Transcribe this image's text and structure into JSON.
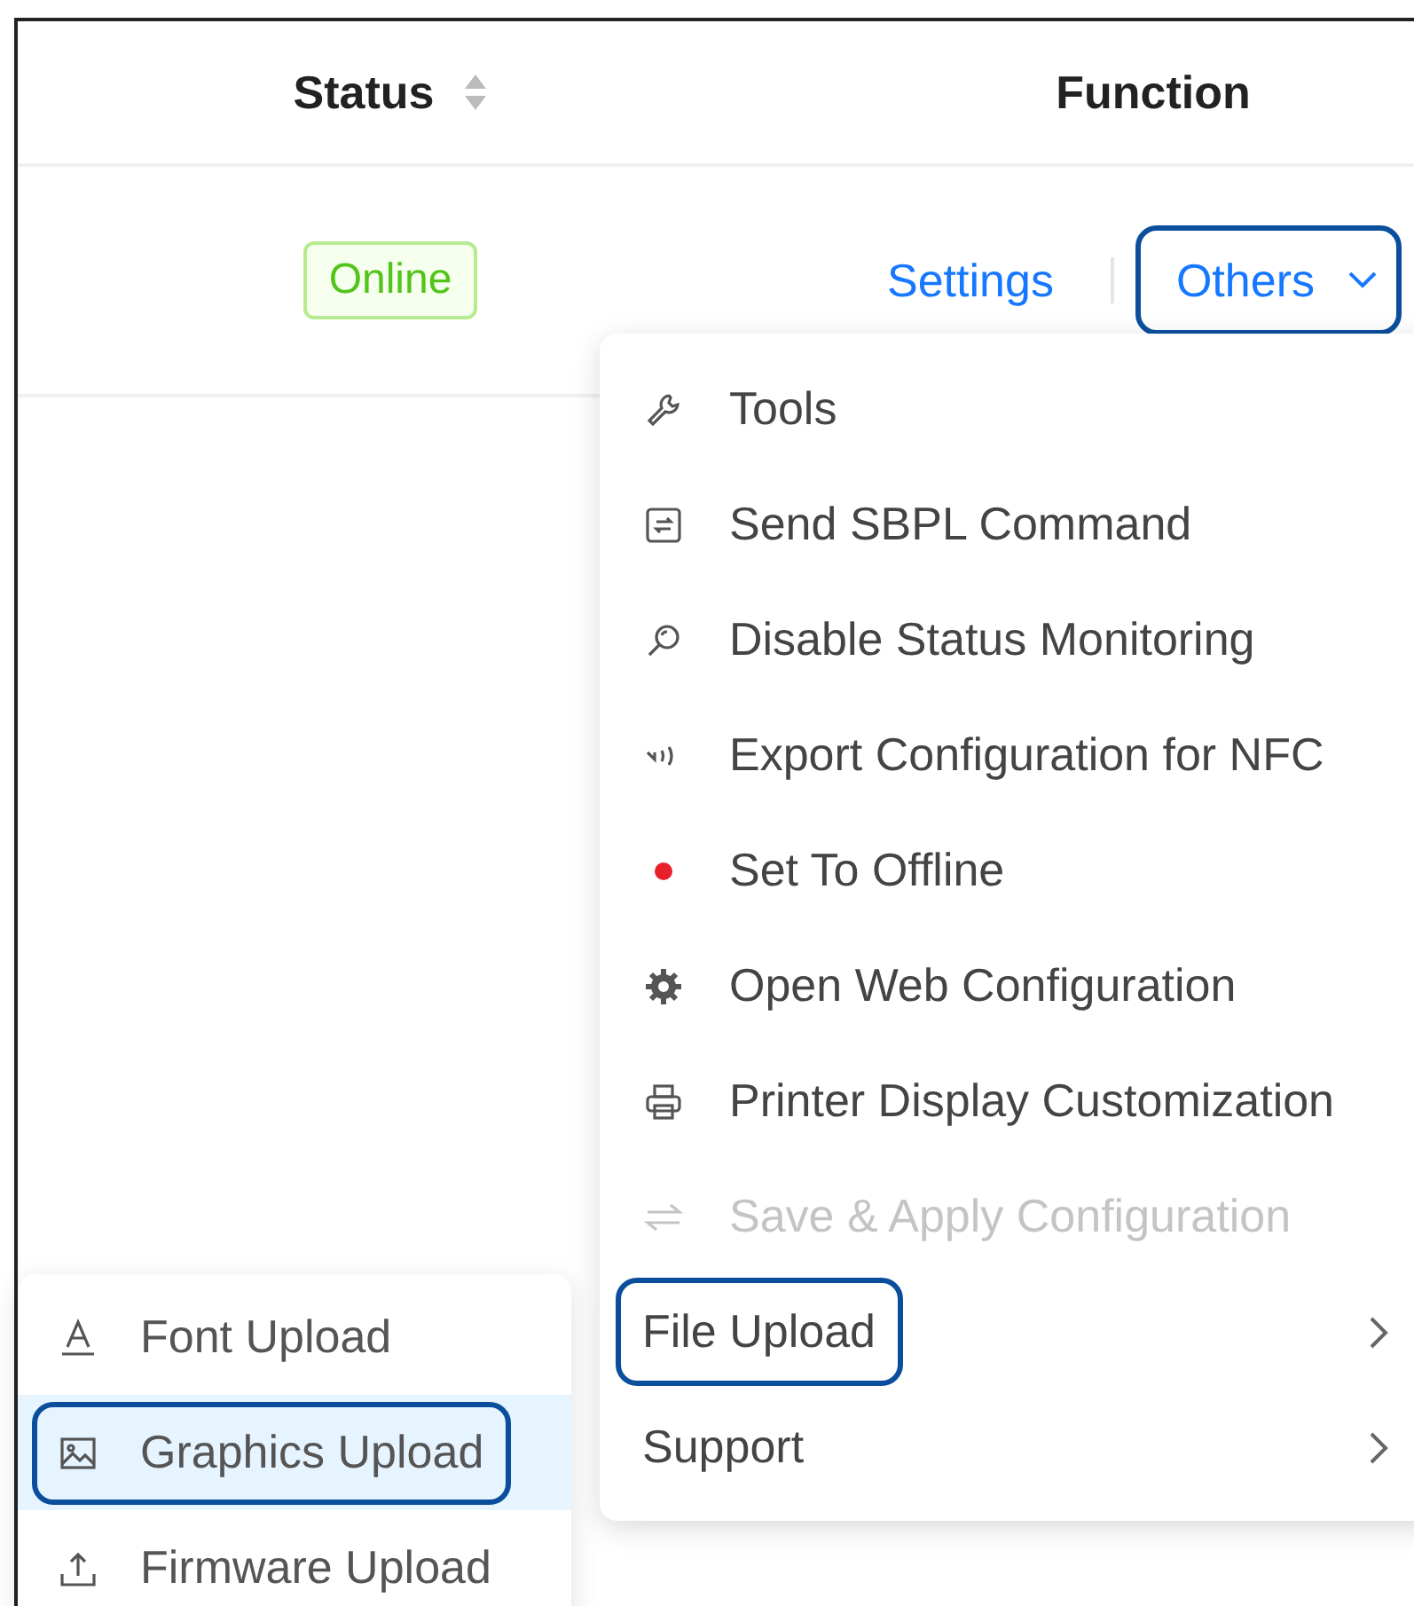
{
  "table": {
    "columns": [
      {
        "label": "Status",
        "sortable": true
      },
      {
        "label": "Function",
        "sortable": false
      }
    ],
    "rows": [
      {
        "status": "Online",
        "actions": {
          "link": "Settings",
          "dropdown": {
            "label": "Others",
            "outlined": true
          }
        }
      }
    ]
  },
  "menu": {
    "items": [
      {
        "label": "Tools",
        "disabled": false,
        "outlined": false,
        "has_submenu": false
      },
      {
        "label": "Send SBPL Command",
        "disabled": false,
        "outlined": false,
        "has_submenu": false
      },
      {
        "label": "Disable Status Monitoring",
        "disabled": false,
        "outlined": false,
        "has_submenu": false
      },
      {
        "label": "Export Configuration for NFC",
        "disabled": false,
        "outlined": false,
        "has_submenu": false
      },
      {
        "label": "Set To Offline",
        "disabled": false,
        "outlined": false,
        "has_submenu": false
      },
      {
        "label": "Open Web Configuration",
        "disabled": false,
        "outlined": false,
        "has_submenu": false
      },
      {
        "label": "Printer Display Customization",
        "disabled": false,
        "outlined": false,
        "has_submenu": false
      },
      {
        "label": "Save & Apply Configuration",
        "disabled": true,
        "outlined": false,
        "has_submenu": false
      },
      {
        "label": "File Upload",
        "disabled": false,
        "outlined": true,
        "has_submenu": true
      },
      {
        "label": "Support",
        "disabled": false,
        "outlined": false,
        "has_submenu": true
      }
    ]
  },
  "submenu": {
    "items": [
      {
        "label": "Font Upload",
        "selected": false,
        "outlined": false
      },
      {
        "label": "Graphics Upload",
        "selected": true,
        "outlined": true
      },
      {
        "label": "Firmware Upload",
        "selected": false,
        "outlined": false
      }
    ]
  }
}
